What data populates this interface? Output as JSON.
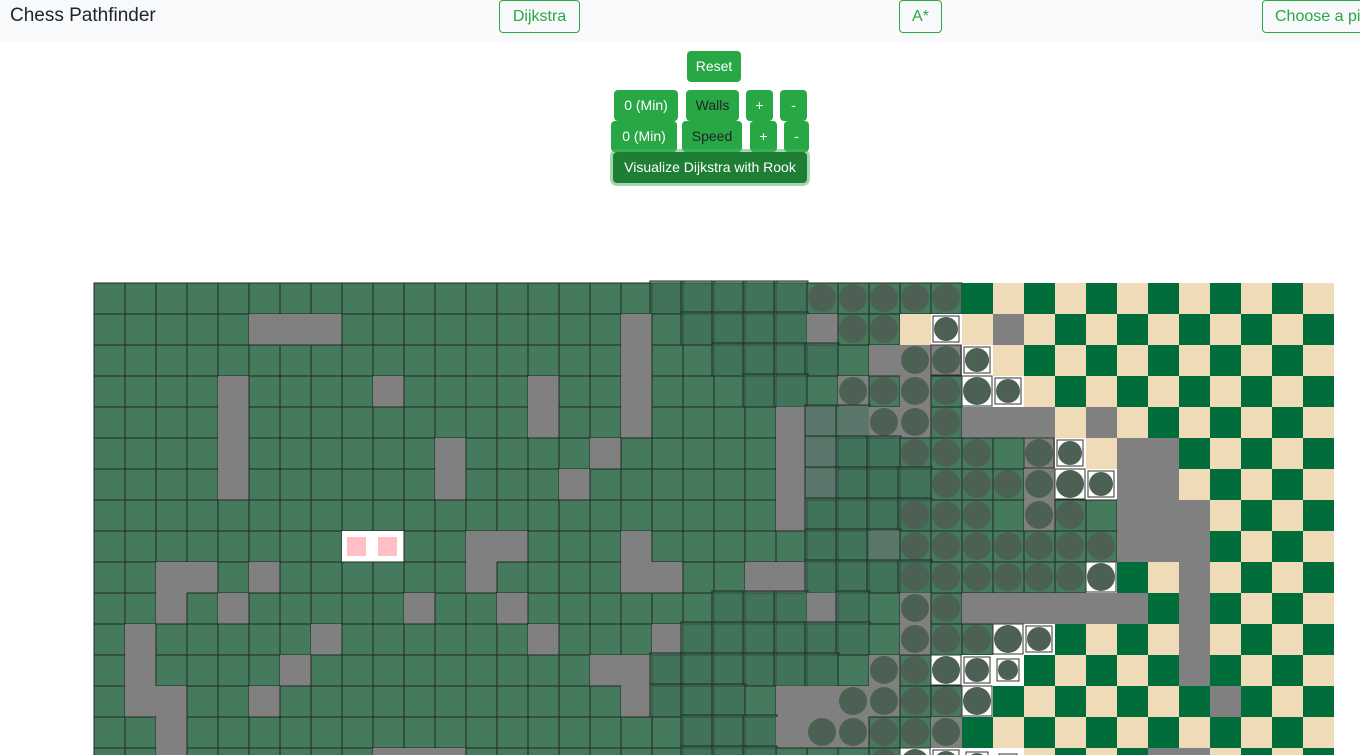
{
  "navbar": {
    "brand": "Chess Pathfinder",
    "dijkstra_label": "Dijkstra",
    "astar_label": "A*",
    "choose_piece_label": "Choose a pi"
  },
  "controls": {
    "reset_label": "Reset",
    "walls_value": "0 (Min)",
    "walls_label": "Walls",
    "walls_plus": "+",
    "walls_minus": "-",
    "speed_value": "0 (Min)",
    "speed_label": "Speed",
    "speed_plus": "+",
    "speed_minus": "-",
    "visualize_label": "Visualize Dijkstra with Rook"
  },
  "colors": {
    "visited": "#457b5c",
    "wall": "#808080",
    "board_dark": "#006d3a",
    "board_light": "#f0dbb8",
    "node_marker": "#4c6153",
    "start_end": "#ffbfc4",
    "accent": "#28a745"
  },
  "grid": {
    "cols": 40,
    "rows_visible": 16,
    "wall_cells": [
      [
        1,
        5
      ],
      [
        1,
        6
      ],
      [
        1,
        7
      ],
      [
        1,
        17
      ],
      [
        1,
        23
      ],
      [
        1,
        29
      ],
      [
        2,
        17
      ],
      [
        2,
        25
      ],
      [
        2,
        26
      ],
      [
        2,
        27
      ],
      [
        3,
        4
      ],
      [
        3,
        9
      ],
      [
        3,
        14
      ],
      [
        3,
        17
      ],
      [
        3,
        24
      ],
      [
        3,
        26
      ],
      [
        4,
        4
      ],
      [
        4,
        14
      ],
      [
        4,
        17
      ],
      [
        4,
        22
      ],
      [
        4,
        23
      ],
      [
        4,
        24
      ],
      [
        4,
        25
      ],
      [
        4,
        26
      ],
      [
        4,
        28
      ],
      [
        4,
        29
      ],
      [
        4,
        30
      ],
      [
        4,
        32
      ],
      [
        5,
        4
      ],
      [
        5,
        11
      ],
      [
        5,
        16
      ],
      [
        5,
        22
      ],
      [
        5,
        23
      ],
      [
        5,
        30
      ],
      [
        5,
        33
      ],
      [
        5,
        34
      ],
      [
        6,
        4
      ],
      [
        6,
        11
      ],
      [
        6,
        15
      ],
      [
        6,
        22
      ],
      [
        6,
        23
      ],
      [
        6,
        30
      ],
      [
        6,
        33
      ],
      [
        6,
        34
      ],
      [
        7,
        22
      ],
      [
        7,
        30
      ],
      [
        7,
        33
      ],
      [
        7,
        34
      ],
      [
        7,
        35
      ],
      [
        8,
        12
      ],
      [
        8,
        13
      ],
      [
        8,
        17
      ],
      [
        8,
        25
      ],
      [
        8,
        33
      ],
      [
        8,
        34
      ],
      [
        8,
        35
      ],
      [
        9,
        2
      ],
      [
        9,
        3
      ],
      [
        9,
        5
      ],
      [
        9,
        12
      ],
      [
        9,
        17
      ],
      [
        9,
        18
      ],
      [
        9,
        21
      ],
      [
        9,
        22
      ],
      [
        9,
        35
      ],
      [
        10,
        2
      ],
      [
        10,
        4
      ],
      [
        10,
        10
      ],
      [
        10,
        13
      ],
      [
        10,
        23
      ],
      [
        10,
        26
      ],
      [
        10,
        28
      ],
      [
        10,
        29
      ],
      [
        10,
        30
      ],
      [
        10,
        31
      ],
      [
        10,
        32
      ],
      [
        10,
        33
      ],
      [
        10,
        35
      ],
      [
        11,
        1
      ],
      [
        11,
        7
      ],
      [
        11,
        14
      ],
      [
        11,
        18
      ],
      [
        11,
        26
      ],
      [
        11,
        35
      ],
      [
        12,
        1
      ],
      [
        12,
        6
      ],
      [
        12,
        16
      ],
      [
        12,
        17
      ],
      [
        12,
        25
      ],
      [
        12,
        35
      ],
      [
        13,
        1
      ],
      [
        13,
        2
      ],
      [
        13,
        5
      ],
      [
        13,
        17
      ],
      [
        13,
        22
      ],
      [
        13,
        23
      ],
      [
        13,
        24
      ],
      [
        13,
        25
      ],
      [
        13,
        36
      ],
      [
        14,
        2
      ],
      [
        14,
        22
      ],
      [
        14,
        23
      ],
      [
        14,
        24
      ],
      [
        14,
        27
      ],
      [
        15,
        2
      ],
      [
        15,
        9
      ],
      [
        15,
        10
      ],
      [
        15,
        11
      ],
      [
        15,
        34
      ],
      [
        15,
        35
      ]
    ],
    "start_end_cells": [
      [
        8,
        8
      ],
      [
        8,
        9
      ]
    ],
    "visited_extent": [
      [
        26,
        28
      ],
      [
        27,
        26
      ],
      [
        28,
        27
      ],
      [
        29,
        28
      ],
      [
        30,
        28
      ],
      [
        31,
        30
      ],
      [
        32,
        31
      ],
      [
        33,
        33
      ],
      [
        34,
        33
      ],
      [
        35,
        32
      ],
      [
        36,
        30
      ],
      [
        37,
        29
      ],
      [
        38,
        27
      ],
      [
        39,
        28
      ],
      [
        40,
        28
      ],
      [
        41,
        26
      ]
    ],
    "marker_cells": [
      [
        0,
        23
      ],
      [
        0,
        24
      ],
      [
        0,
        25
      ],
      [
        0,
        26
      ],
      [
        0,
        27
      ],
      [
        1,
        24
      ],
      [
        1,
        25
      ],
      [
        1,
        27
      ],
      [
        2,
        26
      ],
      [
        2,
        27
      ],
      [
        2,
        28
      ],
      [
        3,
        24
      ],
      [
        3,
        25
      ],
      [
        3,
        26
      ],
      [
        3,
        27
      ],
      [
        3,
        28
      ],
      [
        3,
        29
      ],
      [
        4,
        25
      ],
      [
        4,
        26
      ],
      [
        4,
        27
      ],
      [
        5,
        26
      ],
      [
        5,
        27
      ],
      [
        5,
        28
      ],
      [
        5,
        30
      ],
      [
        5,
        31
      ],
      [
        6,
        27
      ],
      [
        6,
        28
      ],
      [
        6,
        29
      ],
      [
        6,
        30
      ],
      [
        6,
        31
      ],
      [
        6,
        32
      ],
      [
        7,
        26
      ],
      [
        7,
        27
      ],
      [
        7,
        28
      ],
      [
        7,
        30
      ],
      [
        7,
        31
      ],
      [
        8,
        26
      ],
      [
        8,
        27
      ],
      [
        8,
        28
      ],
      [
        8,
        29
      ],
      [
        8,
        30
      ],
      [
        8,
        31
      ],
      [
        8,
        32
      ],
      [
        9,
        26
      ],
      [
        9,
        27
      ],
      [
        9,
        28
      ],
      [
        9,
        29
      ],
      [
        9,
        30
      ],
      [
        9,
        31
      ],
      [
        9,
        32
      ],
      [
        10,
        26
      ],
      [
        10,
        27
      ],
      [
        11,
        26
      ],
      [
        11,
        27
      ],
      [
        11,
        28
      ],
      [
        11,
        29
      ],
      [
        11,
        30
      ],
      [
        12,
        25
      ],
      [
        12,
        26
      ],
      [
        12,
        27
      ],
      [
        12,
        28
      ],
      [
        12,
        29
      ],
      [
        13,
        24
      ],
      [
        13,
        25
      ],
      [
        13,
        26
      ],
      [
        13,
        27
      ],
      [
        13,
        28
      ],
      [
        14,
        23
      ],
      [
        14,
        24
      ],
      [
        14,
        25
      ],
      [
        14,
        26
      ],
      [
        14,
        27
      ],
      [
        15,
        25
      ],
      [
        15,
        26
      ],
      [
        15,
        27
      ],
      [
        15,
        28
      ],
      [
        15,
        29
      ]
    ],
    "highlight_cells": [
      [
        0,
        18
      ],
      [
        0,
        19
      ],
      [
        0,
        20
      ],
      [
        0,
        21
      ],
      [
        0,
        22
      ],
      [
        1,
        19
      ],
      [
        1,
        20
      ],
      [
        1,
        21
      ],
      [
        1,
        22
      ],
      [
        2,
        20
      ],
      [
        2,
        21
      ],
      [
        2,
        22
      ],
      [
        2,
        23
      ],
      [
        3,
        21
      ],
      [
        3,
        22
      ],
      [
        4,
        23
      ],
      [
        4,
        24
      ],
      [
        5,
        23
      ],
      [
        5,
        24
      ],
      [
        5,
        25
      ],
      [
        6,
        23
      ],
      [
        6,
        24
      ],
      [
        6,
        25
      ],
      [
        6,
        26
      ],
      [
        7,
        23
      ],
      [
        7,
        24
      ],
      [
        7,
        25
      ],
      [
        7,
        26
      ],
      [
        8,
        23
      ],
      [
        8,
        24
      ],
      [
        8,
        25
      ],
      [
        9,
        23
      ],
      [
        9,
        24
      ],
      [
        9,
        25
      ],
      [
        9,
        26
      ],
      [
        10,
        20
      ],
      [
        10,
        21
      ],
      [
        10,
        22
      ],
      [
        10,
        24
      ],
      [
        11,
        19
      ],
      [
        11,
        20
      ],
      [
        11,
        21
      ],
      [
        11,
        22
      ],
      [
        11,
        23
      ],
      [
        11,
        24
      ],
      [
        12,
        18
      ],
      [
        12,
        19
      ],
      [
        12,
        20
      ],
      [
        12,
        21
      ],
      [
        12,
        22
      ],
      [
        12,
        23
      ],
      [
        13,
        18
      ],
      [
        13,
        19
      ],
      [
        13,
        20
      ],
      [
        14,
        19
      ],
      [
        14,
        20
      ],
      [
        14,
        21
      ],
      [
        15,
        19
      ],
      [
        15,
        20
      ],
      [
        15,
        21
      ]
    ]
  }
}
